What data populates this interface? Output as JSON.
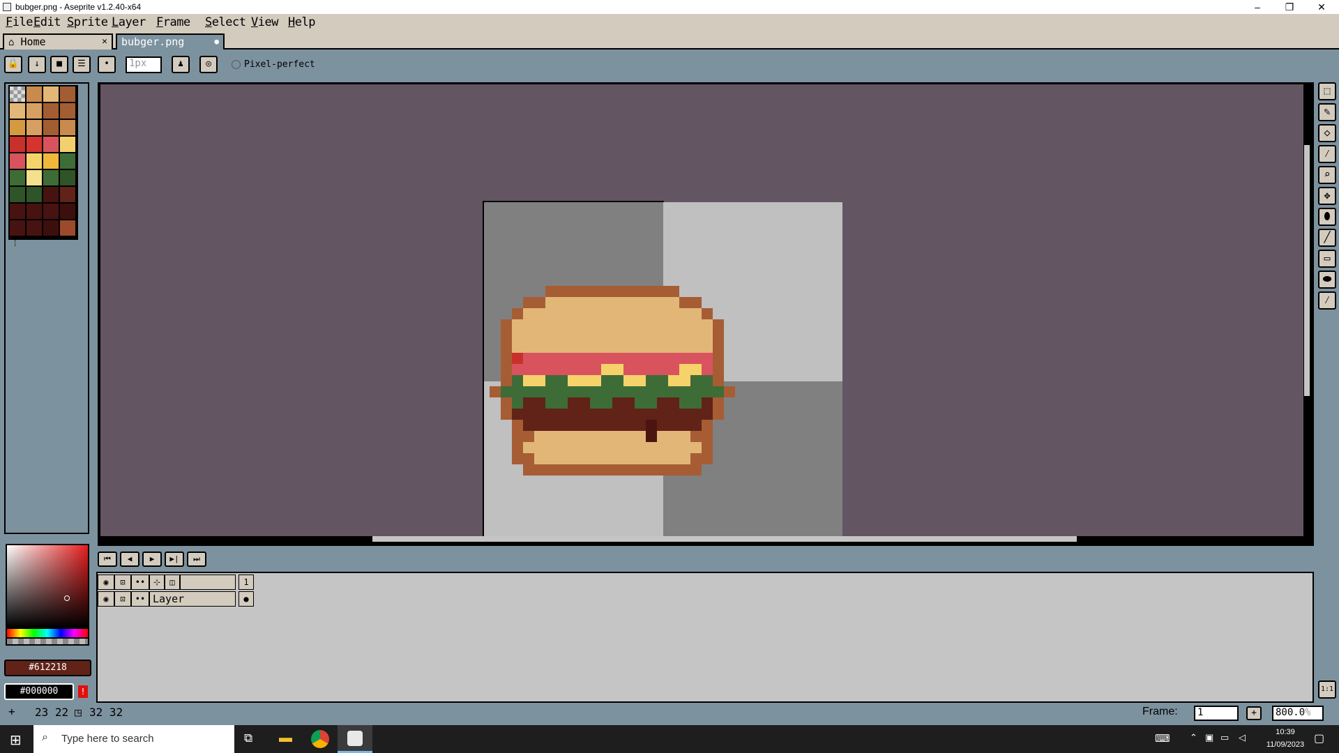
{
  "window": {
    "title": "bubger.png - Aseprite v1.2.40-x64",
    "minimize": "–",
    "restore": "❐",
    "close": "✕"
  },
  "menu": [
    "File",
    "Edit",
    "Sprite",
    "Layer",
    "Frame",
    "Select",
    "View",
    "Help"
  ],
  "tabs": [
    {
      "label": "Home",
      "icon": "home-icon",
      "close": "✕"
    },
    {
      "label": "bubger.png",
      "modified": "●"
    }
  ],
  "toolbar": {
    "brush_size_placeholder": "1px",
    "pixel_perfect_label": "Pixel-perfect",
    "brush_type": "•"
  },
  "palette": {
    "colors": [
      "transparent",
      "#c98a4e",
      "#e2b777",
      "#a35d33",
      "#e2b777",
      "#d6a062",
      "#a35d33",
      "#a35d33",
      "#d59a3f",
      "#d6a062",
      "#a35d33",
      "#c98a4e",
      "#c9302c",
      "#d5342f",
      "#d8535e",
      "#f2d06d",
      "#d8535e",
      "#f5d36a",
      "#f0b73a",
      "#3e6c36",
      "#3e6c36",
      "#f5e08d",
      "#3e6c36",
      "#2f5427",
      "#2f5427",
      "#2f5427",
      "#461311",
      "#612218",
      "#461311",
      "#461311",
      "#461311",
      "#3c0f0d",
      "#461311",
      "#461311",
      "#3c0f0d",
      "#9c4a2b"
    ],
    "menu_icon": "≡"
  },
  "colors": {
    "foreground_hex": "#612218",
    "background_hex": "#000000",
    "warning": "!"
  },
  "timeline": {
    "play_buttons": [
      "⏮",
      "◀",
      "▶",
      "▶|",
      "⏭"
    ],
    "header_icons": [
      "eye-icon",
      "lock-icon",
      "continuous-icon",
      "link-icon",
      "onion-icon"
    ],
    "frame_number": "1",
    "layer_name": "Layer",
    "cel": "●"
  },
  "status": {
    "cursor": "23 22",
    "size": "32 32",
    "frame_label": "Frame:",
    "frame_value": "1",
    "zoom": "800.0",
    "zoom_unit": "%",
    "one_to_one": "1:1"
  },
  "taskbar": {
    "search_placeholder": "Type here to search",
    "time": "10:39",
    "date": "11/09/2023"
  }
}
